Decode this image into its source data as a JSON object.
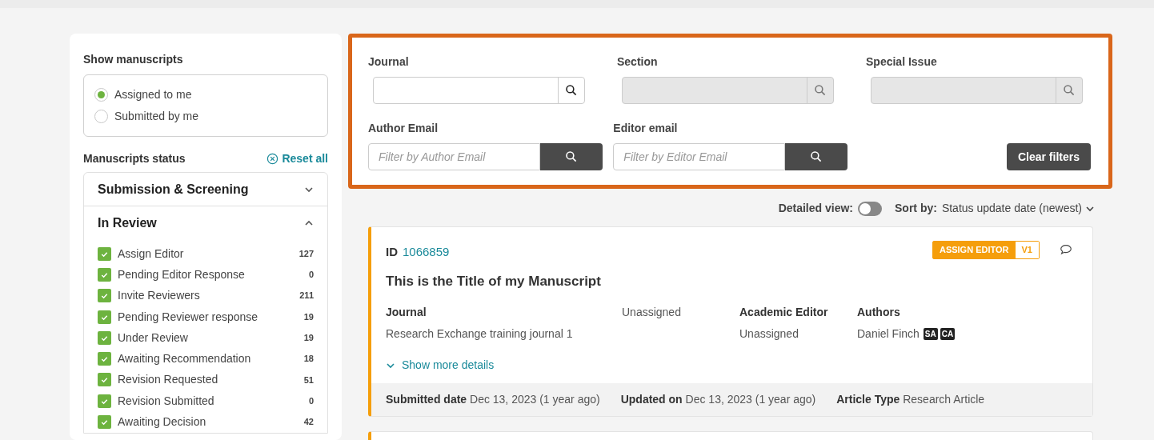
{
  "sidebar": {
    "show_title": "Show manuscripts",
    "show_options": [
      {
        "label": "Assigned to me",
        "selected": true
      },
      {
        "label": "Submitted by me",
        "selected": false
      }
    ],
    "status_title": "Manuscripts status",
    "reset": "Reset all",
    "groups": [
      {
        "title": "Submission & Screening",
        "expanded": false
      },
      {
        "title": "In Review",
        "expanded": true,
        "items": [
          {
            "label": "Assign Editor",
            "count": "127",
            "checked": true
          },
          {
            "label": "Pending Editor Response",
            "count": "0",
            "checked": true
          },
          {
            "label": "Invite Reviewers",
            "count": "211",
            "checked": true
          },
          {
            "label": "Pending Reviewer response",
            "count": "19",
            "checked": true
          },
          {
            "label": "Under Review",
            "count": "19",
            "checked": true
          },
          {
            "label": "Awaiting Recommendation",
            "count": "18",
            "checked": true
          },
          {
            "label": "Revision Requested",
            "count": "51",
            "checked": true
          },
          {
            "label": "Revision Submitted",
            "count": "0",
            "checked": true
          },
          {
            "label": "Awaiting Decision",
            "count": "42",
            "checked": true
          }
        ]
      }
    ]
  },
  "filters": {
    "lookups": [
      {
        "label": "Journal",
        "disabled": false
      },
      {
        "label": "Section",
        "disabled": true
      },
      {
        "label": "Special Issue",
        "disabled": true
      }
    ],
    "emails": [
      {
        "label": "Author Email",
        "placeholder": "Filter by Author Email"
      },
      {
        "label": "Editor email",
        "placeholder": "Filter by Editor Email"
      }
    ],
    "clear": "Clear filters"
  },
  "toolbar": {
    "detailed_label": "Detailed view:",
    "detailed_on": false,
    "sort_label": "Sort by:",
    "sort_value": "Status update date (newest)"
  },
  "manuscripts": [
    {
      "id_label": "ID",
      "id": "1066859",
      "status": "ASSIGN EDITOR",
      "version": "V1",
      "title": "This is the Title of my Manuscript",
      "journal_label": "Journal",
      "journal": "Research Exchange training journal 1",
      "section": "Unassigned",
      "editor_label": "Academic Editor",
      "editor": "Unassigned",
      "authors_label": "Authors",
      "author": "Daniel Finch",
      "author_tags": [
        "SA",
        "CA"
      ],
      "more": "Show more details",
      "footer": [
        {
          "label": "Submitted date",
          "value": "Dec 13, 2023 (1 year ago)"
        },
        {
          "label": "Updated on",
          "value": "Dec 13, 2023 (1 year ago)"
        },
        {
          "label": "Article Type",
          "value": "Research Article"
        }
      ]
    }
  ]
}
